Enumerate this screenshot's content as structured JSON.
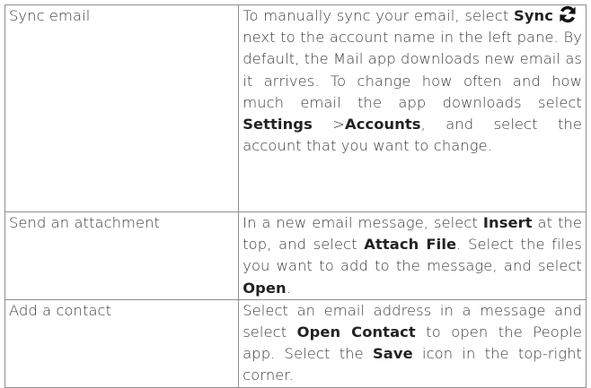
{
  "table": {
    "rows": [
      {
        "feature": "Sync email",
        "desc": {
          "t1": "To manually sync your email, select ",
          "b1": "Sync",
          "t2": " next to the account name in the left pane. By default, the Mail app downloads new email as it arrives. To change how often and how much email the app downloads select ",
          "b2": "Settings",
          "t3": " >",
          "b3": "Accounts",
          "t4": ", and select the account that you want to change."
        },
        "icon": "sync-icon"
      },
      {
        "feature": "Send an attachment",
        "desc": {
          "t1": "In a new email message, select ",
          "b1": "Insert",
          "t2": " at the top, and select ",
          "b2": "Attach File",
          "t3": ". Select the files you want to add to the message, and select ",
          "b3": "Open",
          "t4": "."
        }
      },
      {
        "feature": "Add a contact",
        "desc": {
          "t1": "Select an email address in a message and select ",
          "b1": "Open Contact",
          "t2": " to open the People app. Select the ",
          "b2": "Save",
          "t3": " icon in the top-right corner."
        }
      }
    ]
  }
}
